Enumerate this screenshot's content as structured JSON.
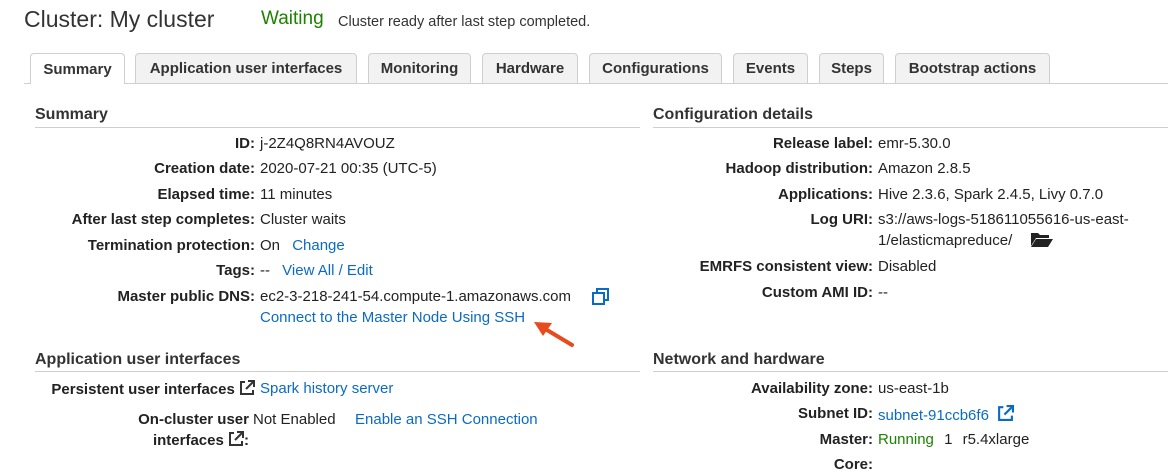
{
  "header": {
    "title": "Cluster: My cluster",
    "status": "Waiting",
    "status_message": "Cluster ready after last step completed."
  },
  "tabs": [
    {
      "label": "Summary",
      "active": true
    },
    {
      "label": "Application user interfaces"
    },
    {
      "label": "Monitoring"
    },
    {
      "label": "Hardware"
    },
    {
      "label": "Configurations"
    },
    {
      "label": "Events"
    },
    {
      "label": "Steps"
    },
    {
      "label": "Bootstrap actions"
    }
  ],
  "summary": {
    "title": "Summary",
    "id_label": "ID:",
    "id_value": "j-2Z4Q8RN4AVOUZ",
    "creation_label": "Creation date:",
    "creation_value": "2020-07-21 00:35 (UTC-5)",
    "elapsed_label": "Elapsed time:",
    "elapsed_value": "11 minutes",
    "after_step_label": "After last step completes:",
    "after_step_value": "Cluster waits",
    "termination_label": "Termination protection:",
    "termination_value": "On",
    "termination_link": "Change",
    "tags_label": "Tags:",
    "tags_value": "--",
    "tags_link": "View All / Edit",
    "dns_label": "Master public DNS:",
    "dns_value": "ec2-3-218-241-54.compute-1.amazonaws.com",
    "ssh_link": "Connect to the Master Node Using SSH"
  },
  "app_ui": {
    "title": "Application user interfaces",
    "persistent_label": "Persistent user interfaces",
    "persistent_link": "Spark history server",
    "oncluster_label_line1": "On-cluster user",
    "oncluster_label_line2": "interfaces",
    "oncluster_colon": ":",
    "oncluster_value": "Not Enabled",
    "oncluster_link": "Enable an SSH Connection"
  },
  "config": {
    "title": "Configuration details",
    "release_label": "Release label:",
    "release_value": "emr-5.30.0",
    "hadoop_label": "Hadoop distribution:",
    "hadoop_value": "Amazon 2.8.5",
    "apps_label": "Applications:",
    "apps_value": "Hive 2.3.6, Spark 2.4.5, Livy 0.7.0",
    "log_label": "Log URI:",
    "log_value_line1": "s3://aws-logs-518611055616-us-east-",
    "log_value_line2": "1/elasticmapreduce/",
    "emrfs_label": "EMRFS consistent view:",
    "emrfs_value": "Disabled",
    "ami_label": "Custom AMI ID:",
    "ami_value": "--"
  },
  "network": {
    "title": "Network and hardware",
    "az_label": "Availability zone:",
    "az_value": "us-east-1b",
    "subnet_label": "Subnet ID:",
    "subnet_value": "subnet-91ccb6f6",
    "master_label": "Master:",
    "master_status": "Running",
    "master_count": "1",
    "master_type": "r5.4xlarge",
    "core_label": "Core:"
  },
  "colors": {
    "link": "#0b6bc4",
    "status_green": "#1d8102",
    "annotation_arrow": "#e8491d"
  },
  "icons": [
    "copy-icon",
    "external-link-icon",
    "folder-icon",
    "annotation-arrow"
  ]
}
